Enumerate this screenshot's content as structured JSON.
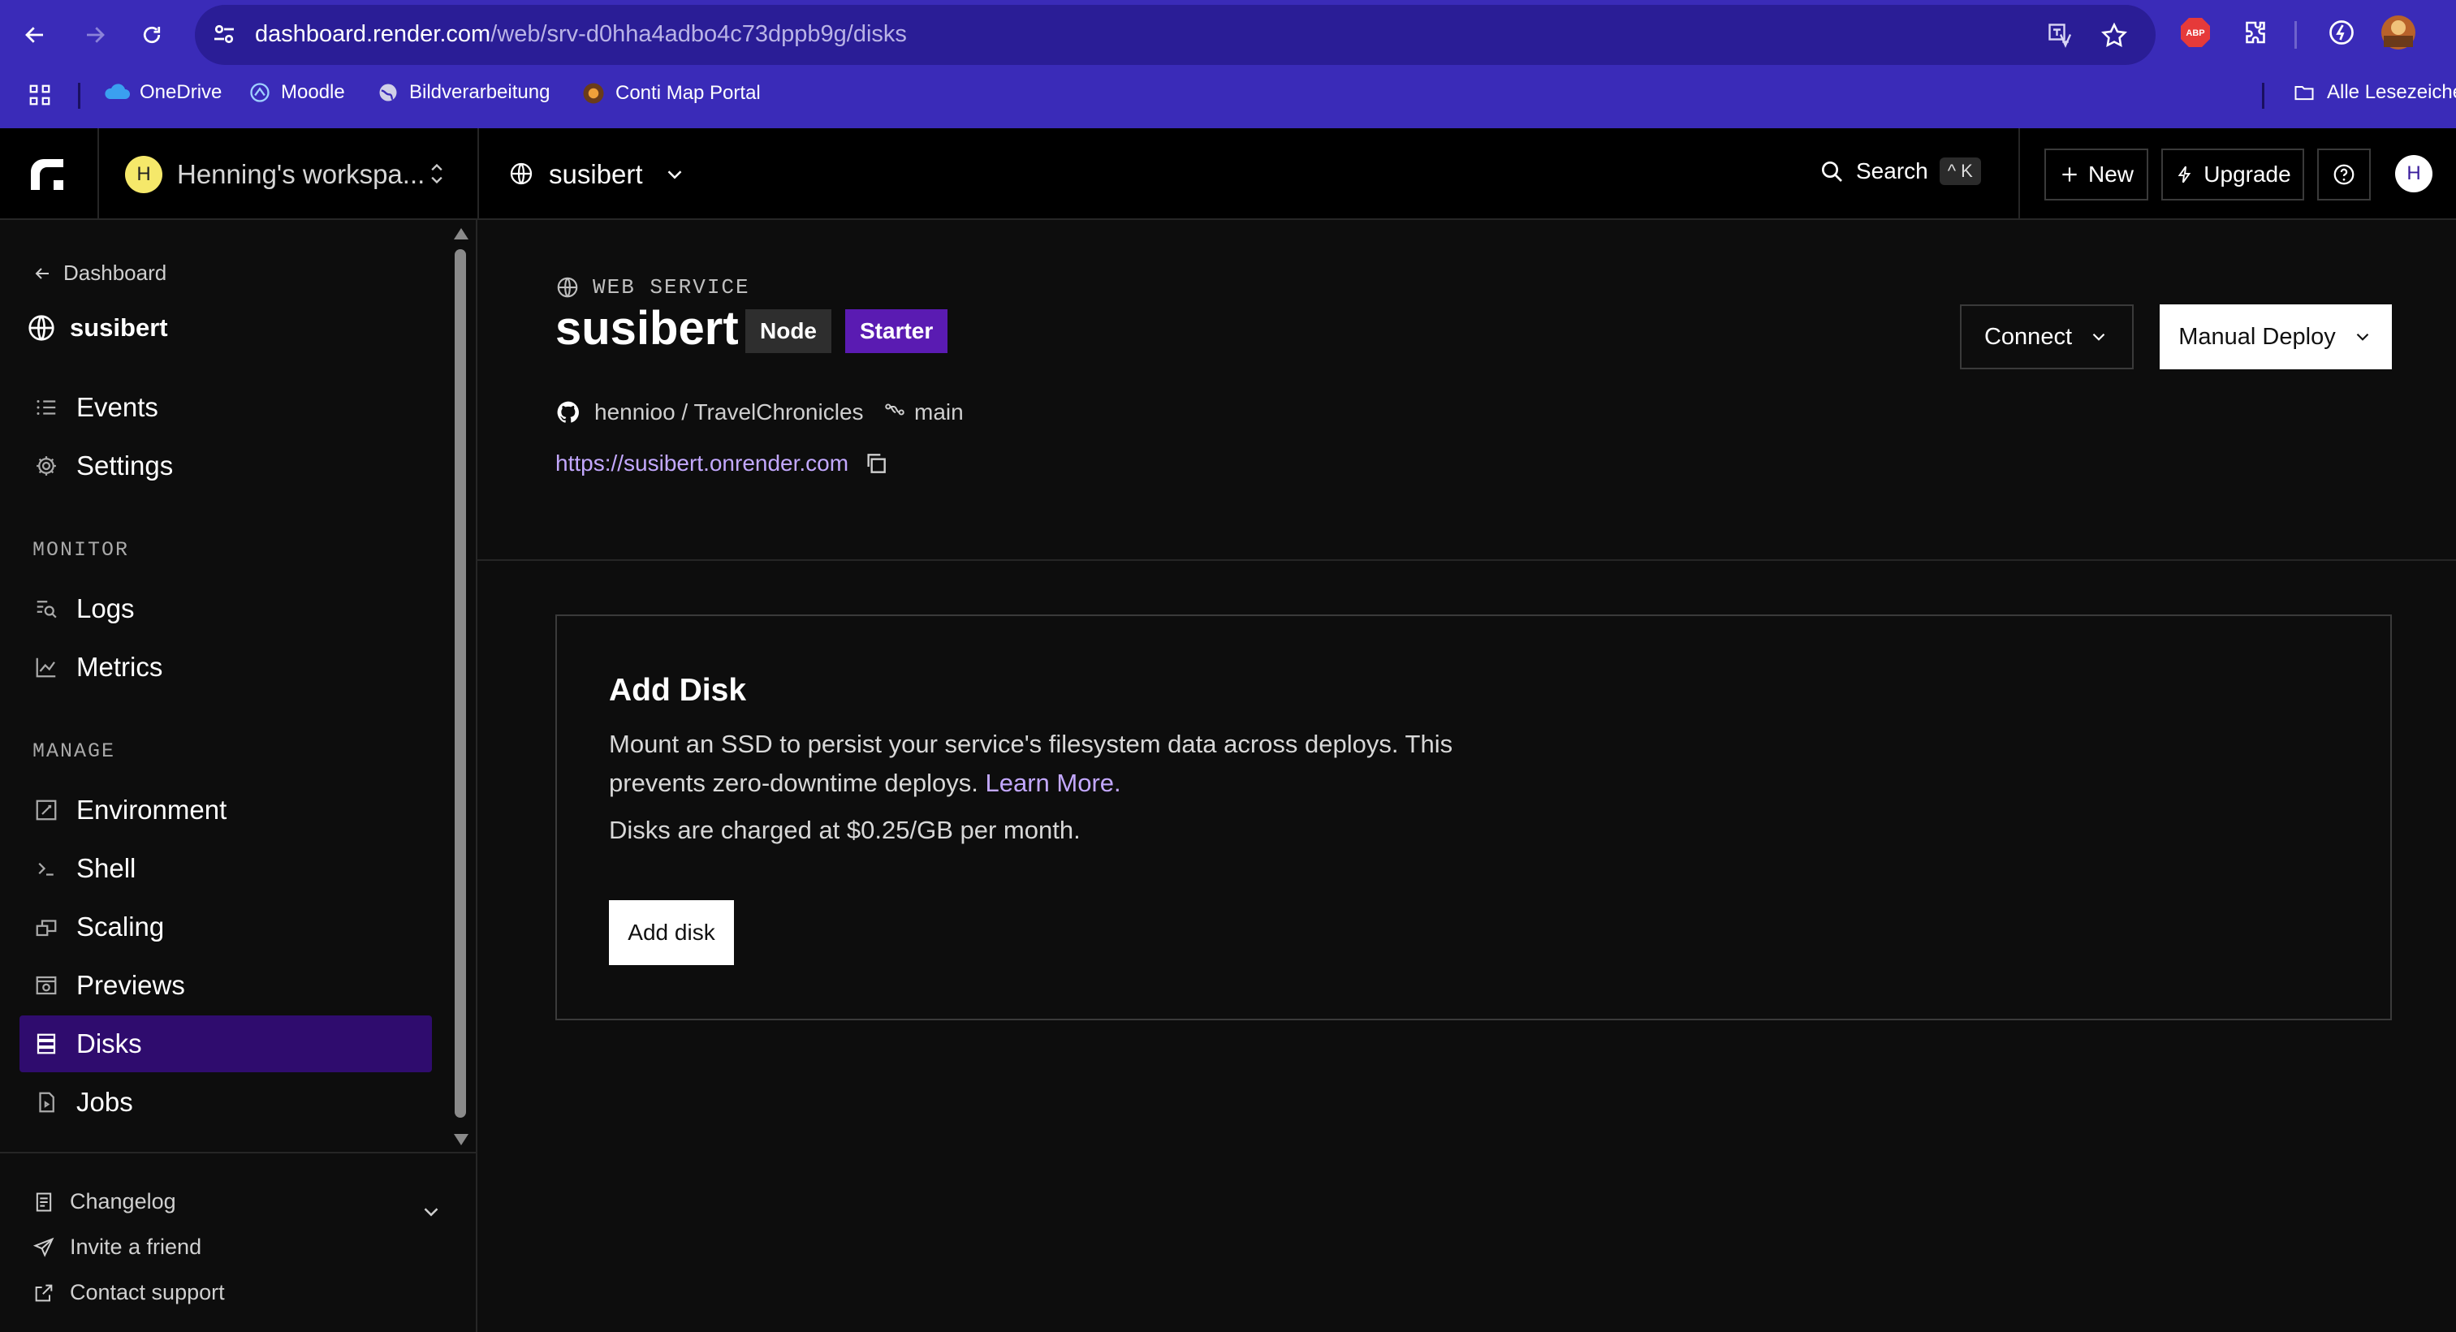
{
  "browser": {
    "url_host": "dashboard.render.com",
    "url_path": "/web/srv-d0hha4adbo4c73dppb9g/disks",
    "bookmarks": [
      {
        "label": "OneDrive",
        "icon": "cloud-icon"
      },
      {
        "label": "Moodle",
        "icon": "moodle-icon"
      },
      {
        "label": "Bildverarbeitung",
        "icon": "globe-icon"
      },
      {
        "label": "Conti Map Portal",
        "icon": "map-portal-icon"
      }
    ],
    "all_bookmarks_label": "Alle Lesezeiche",
    "abp_label": "ABP"
  },
  "header": {
    "workspace_initial": "H",
    "workspace_name": "Henning's workspa...",
    "service_name": "susibert",
    "search_label": "Search",
    "search_shortcut": "^ K",
    "new_label": "New",
    "upgrade_label": "Upgrade",
    "user_initial": "H"
  },
  "sidebar": {
    "back_label": "Dashboard",
    "service_name": "susibert",
    "top_items": [
      {
        "label": "Events",
        "icon": "list-icon"
      },
      {
        "label": "Settings",
        "icon": "gear-icon"
      }
    ],
    "monitor_title": "MONITOR",
    "monitor_items": [
      {
        "label": "Logs",
        "icon": "logs-icon"
      },
      {
        "label": "Metrics",
        "icon": "metrics-icon"
      }
    ],
    "manage_title": "MANAGE",
    "manage_items": [
      {
        "label": "Environment",
        "icon": "environment-icon"
      },
      {
        "label": "Shell",
        "icon": "shell-icon"
      },
      {
        "label": "Scaling",
        "icon": "scaling-icon"
      },
      {
        "label": "Previews",
        "icon": "previews-icon"
      },
      {
        "label": "Disks",
        "icon": "disks-icon",
        "active": true
      },
      {
        "label": "Jobs",
        "icon": "jobs-icon"
      }
    ],
    "footer": {
      "changelog": "Changelog",
      "invite": "Invite a friend",
      "support": "Contact support"
    }
  },
  "service": {
    "type_label": "WEB SERVICE",
    "name": "susibert",
    "runtime_tag": "Node",
    "plan_tag": "Starter",
    "repo": "hennioo / TravelChronicles",
    "branch": "main",
    "url": "https://susibert.onrender.com",
    "connect_label": "Connect",
    "manual_deploy_label": "Manual Deploy"
  },
  "disk_card": {
    "title": "Add Disk",
    "description": "Mount an SSD to persist your service's filesystem data across deploys. This prevents zero-downtime deploys.",
    "learn_more": "Learn More.",
    "pricing": "Disks are charged at $0.25/GB per month.",
    "add_button": "Add disk"
  },
  "colors": {
    "browser_chrome": "#3a2bb8",
    "accent_purple": "#5a1bb2",
    "active_nav": "#2f0c6e",
    "link": "#c3a8ff"
  }
}
